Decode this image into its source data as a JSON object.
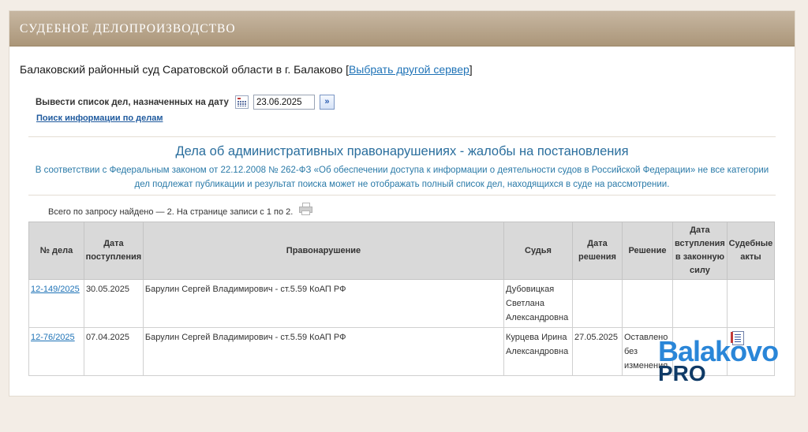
{
  "banner": {
    "title": "СУДЕБНОЕ ДЕЛОПРОИЗВОДСТВО"
  },
  "court": {
    "name": "Балаковский районный суд Саратовской области в г. Балаково",
    "open_bracket": "[",
    "change_server_link": "Выбрать другой сервер",
    "close_bracket": "]"
  },
  "date_filter": {
    "label": "Вывести список дел, назначенных на дату",
    "value": "23.06.2025",
    "calendar_icon": "calendar-icon",
    "go_icon": "double-chevron-right-icon"
  },
  "search_link": "Поиск информации по делам",
  "heading": "Дела об административных правонарушениях - жалобы на постановления",
  "notice": "В соответствии с Федеральным законом от 22.12.2008 № 262-ФЗ «Об обеспечении доступа к информации о деятельности судов в Российской Федерации» не все категории дел подлежат публикации и результат поиска может не отображать полный список дел, находящихся в суде на рассмотрении.",
  "results": {
    "count_text": "Всего по запросу найдено — 2. На странице записи с 1 по 2.",
    "print_icon": "printer-icon"
  },
  "table": {
    "headers": {
      "case_no": "№ дела",
      "received": "Дата поступления",
      "offense": "Правонарушение",
      "judge": "Судья",
      "decision_date": "Дата решения",
      "decision": "Решение",
      "effective_date": "Дата вступления в законную силу",
      "acts": "Судебные акты"
    },
    "rows": [
      {
        "case_no": "12-149/2025",
        "received": "30.05.2025",
        "offense": "Барулин Сергей Владимирович - ст.5.59 КоАП РФ",
        "judge": "Дубовицкая Светлана Александровна",
        "decision_date": "",
        "decision": "",
        "effective_date": "",
        "has_act": false
      },
      {
        "case_no": "12-76/2025",
        "received": "07.04.2025",
        "offense": "Барулин Сергей Владимирович - ст.5.59 КоАП РФ",
        "judge": "Курцева Ирина Александровна",
        "decision_date": "27.05.2025",
        "decision": "Оставлено без изменения",
        "effective_date": "",
        "has_act": true,
        "act_icon": "document-icon"
      }
    ]
  },
  "watermark": {
    "top": "Balakovo",
    "bottom": "PRO",
    "colors": {
      "top": "#2a86d8",
      "bottom": "#0f3a66"
    }
  },
  "colors": {
    "banner": "#b8a589",
    "link": "#1f73b7",
    "heading": "#2a6e9d"
  }
}
